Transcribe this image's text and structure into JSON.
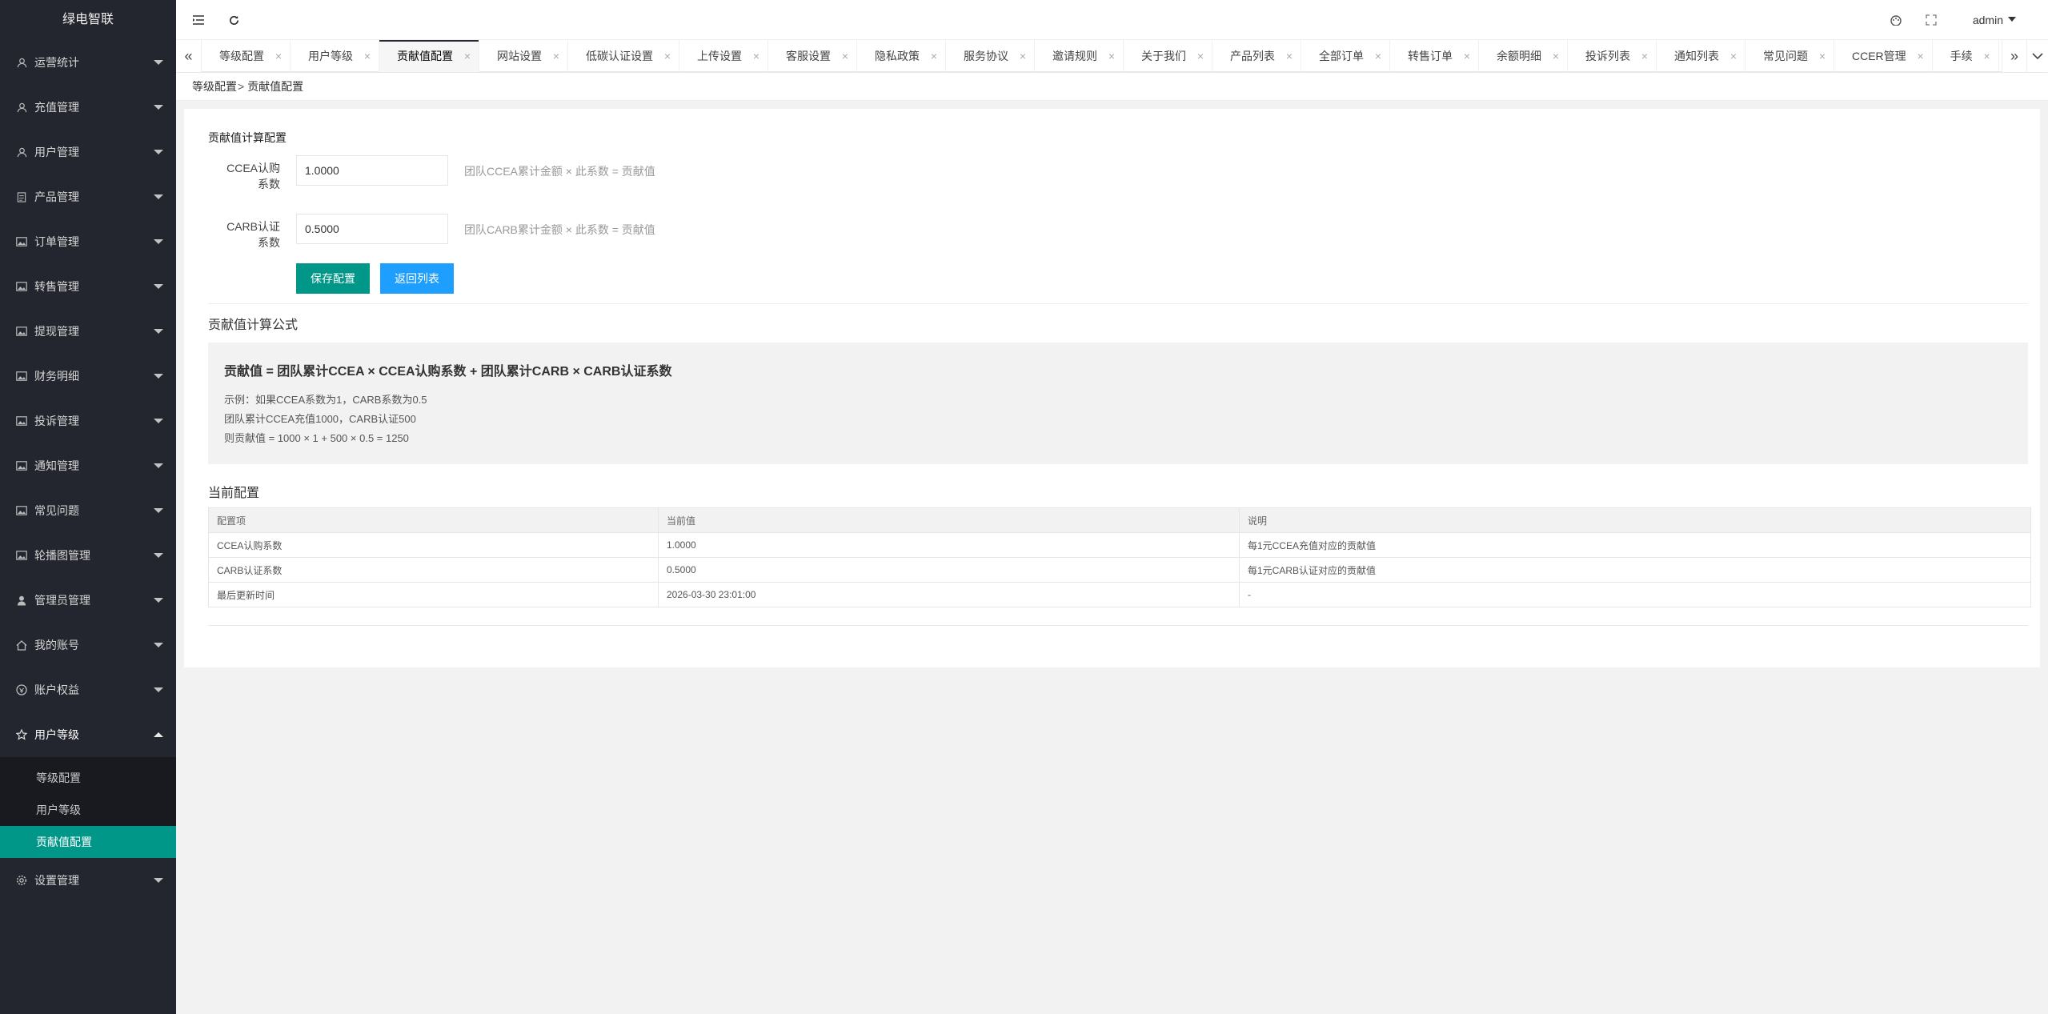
{
  "app": {
    "name": "绿电智联"
  },
  "sidebar": {
    "items": [
      {
        "label": "运营统计",
        "icon": "person-icon"
      },
      {
        "label": "充值管理",
        "icon": "person-icon"
      },
      {
        "label": "用户管理",
        "icon": "person-icon"
      },
      {
        "label": "产品管理",
        "icon": "document-icon"
      },
      {
        "label": "订单管理",
        "icon": "image-icon"
      },
      {
        "label": "转售管理",
        "icon": "image-icon"
      },
      {
        "label": "提现管理",
        "icon": "image-icon"
      },
      {
        "label": "财务明细",
        "icon": "image-icon"
      },
      {
        "label": "投诉管理",
        "icon": "image-icon"
      },
      {
        "label": "通知管理",
        "icon": "image-icon"
      },
      {
        "label": "常见问题",
        "icon": "image-icon"
      },
      {
        "label": "轮播图管理",
        "icon": "image-icon"
      },
      {
        "label": "管理员管理",
        "icon": "user-icon"
      },
      {
        "label": "我的账号",
        "icon": "home-icon"
      },
      {
        "label": "账户权益",
        "icon": "circle-icon"
      },
      {
        "label": "用户等级",
        "icon": "star-icon"
      }
    ],
    "sub_items": [
      {
        "label": "等级配置"
      },
      {
        "label": "用户等级"
      },
      {
        "label": "贡献值配置"
      }
    ],
    "settings": {
      "label": "设置管理",
      "icon": "gear-icon"
    }
  },
  "header": {
    "user": "admin"
  },
  "tabs": [
    "等级配置",
    "用户等级",
    "贡献值配置",
    "网站设置",
    "低碳认证设置",
    "上传设置",
    "客服设置",
    "隐私政策",
    "服务协议",
    "邀请规则",
    "关于我们",
    "产品列表",
    "全部订单",
    "转售订单",
    "余额明细",
    "投诉列表",
    "通知列表",
    "常见问题",
    "CCER管理",
    "手续"
  ],
  "breadcrumb": {
    "parent": "等级配置",
    "sep": ">",
    "current": "贡献值配置"
  },
  "form": {
    "section_title": "贡献值计算配置",
    "ccea": {
      "label_line1": "CCEA认购",
      "label_line2": "系数",
      "value": "1.0000",
      "hint": "团队CCEA累计金额 × 此系数 = 贡献值"
    },
    "carb": {
      "label_line1": "CARB认证",
      "label_line2": "系数",
      "value": "0.5000",
      "hint": "团队CARB累计金额 × 此系数 = 贡献值"
    },
    "save_label": "保存配置",
    "back_label": "返回列表"
  },
  "formula": {
    "title": "贡献值计算公式",
    "main": "贡献值 = 团队累计CCEA × CCEA认购系数 + 团队累计CARB × CARB认证系数",
    "example_1": "示例：如果CCEA系数为1，CARB系数为0.5",
    "example_2": "团队累计CCEA充值1000，CARB认证500",
    "example_3": "则贡献值 = 1000 × 1 + 500 × 0.5 = 1250"
  },
  "current_config": {
    "title": "当前配置",
    "headers": [
      "配置项",
      "当前值",
      "说明"
    ],
    "rows": [
      [
        "CCEA认购系数",
        "1.0000",
        "每1元CCEA充值对应的贡献值"
      ],
      [
        "CARB认证系数",
        "0.5000",
        "每1元CARB认证对应的贡献值"
      ],
      [
        "最后更新时间",
        "2026-03-30 23:01:00",
        "-"
      ]
    ]
  },
  "colors": {
    "accent": "#009688",
    "blue": "#1e9fff",
    "sidebar": "#23262e"
  }
}
